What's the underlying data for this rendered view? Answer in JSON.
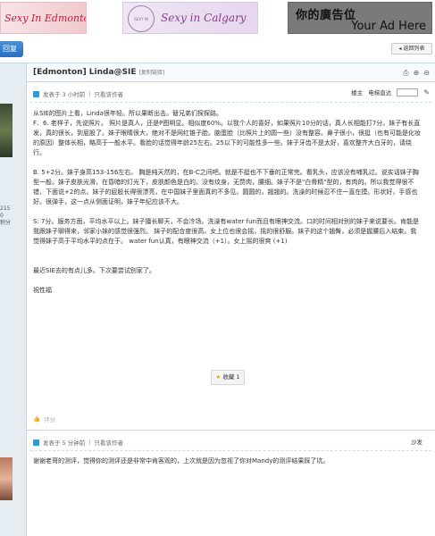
{
  "banners": [
    {
      "text": "Sexy In Edmonton"
    },
    {
      "text": "Sexy in Calgary",
      "seal": "SEXY IN CALGARY"
    },
    {
      "line1": "你的廣告位",
      "line2": "Your Ad Here"
    }
  ],
  "actions": {
    "reply_label": "回复",
    "back_label": "◂ 返回列表"
  },
  "thread": {
    "title": "[Edmonton] Linda@SIE",
    "copy_link": "[复制链接]"
  },
  "post1": {
    "meta_time": "发表于 3 小时前",
    "author_only": "只看该作者",
    "floor": "楼主",
    "jump_label": "电梯直达",
    "left_stats": [
      "215",
      "0",
      "积分"
    ],
    "paragraphs": [
      "从SIE的图片上看，Linda很年轻。所以果断出击。替兄弟们探探路。",
      "F．6. 老样子，先说照片。 照片是真人，还是P图明显。相似度60%。以我个人的喜好，如果照片10分的话，真人长相能打7分。妹子有长直发，真的很长，到屁股了。妹子眼睛很大，绝对不是网红锥子脸。脑蛋脸（比照片上的圆一些）没有整容。鼻子很小，很挺（也有可能是化妆的原因）整体长相，略高于一般水平。看脸的话觉得年龄25左右。25以下的可能性多一些。妹子牙齿不是太好，喜欢整齐大白牙的，请绕行。",
      "B. 5+2分。妹子身高153-156左右。 胸是纯天然的，在B-C之间吧。就是不挺也不下垂的正常完。看乳头，应该没有哺乳过。说实话妹子胸型一般。妹子皮肤光滑，在昏暗的灯光下，皮肤颜色是白的。没有纹身，无赘肉，腰细。妹子不是\"白骨精\"型的，有肉的。所以我觉得很不错，下面说+2的点。妹子的屁股长得很漂亮，在中国妹子里面真的不多见。圆圆的，翘翘的。洗澡的时候忍不住一直在摸。形状好，手感也好。很弹手，这一点从侧面证明，妹子年纪应该不大。",
      "S: 7分。服务方面，平均水平以上。妹子擅长聊天，不会冷场。洗澡有water fun而且有眼神交流。口的时间相对别的妹子来说要长。肯能是我跟妹子聊得来，邻家小妹的感觉很强烈。 妹子的配合度很高。女上位也很会摇，摇的很舒服。妹子的这个翘臀，必须是握腰后入结束。我觉得妹子高于平均水平的点在于。 water fun认真，有眼神交流（+1）。女上摇的很爽 (+1)",
      "最近SIE去的有点儿多。下次要尝试别家了。",
      "祝性福"
    ],
    "fav_label": "收藏",
    "fav_count": "1",
    "rate_label": "评分"
  },
  "post2": {
    "meta_time": "发表于 5 分钟前",
    "author_only": "只看该作者",
    "floor": "沙发",
    "body": "谢谢老哥的测评，觉得你的测评还是非常中肯客观的，上次就是因为忽视了你对Mandy的测评结果踩了坑。"
  },
  "colors": {
    "accent": "#2a6fc0",
    "border": "#c2d5e3",
    "sidebar": "#e5edf2"
  },
  "icons": [
    "print-icon",
    "zoom-in-icon",
    "zoom-out-icon",
    "edit-icon",
    "star-icon",
    "thumb-icon",
    "online-status-icon"
  ]
}
